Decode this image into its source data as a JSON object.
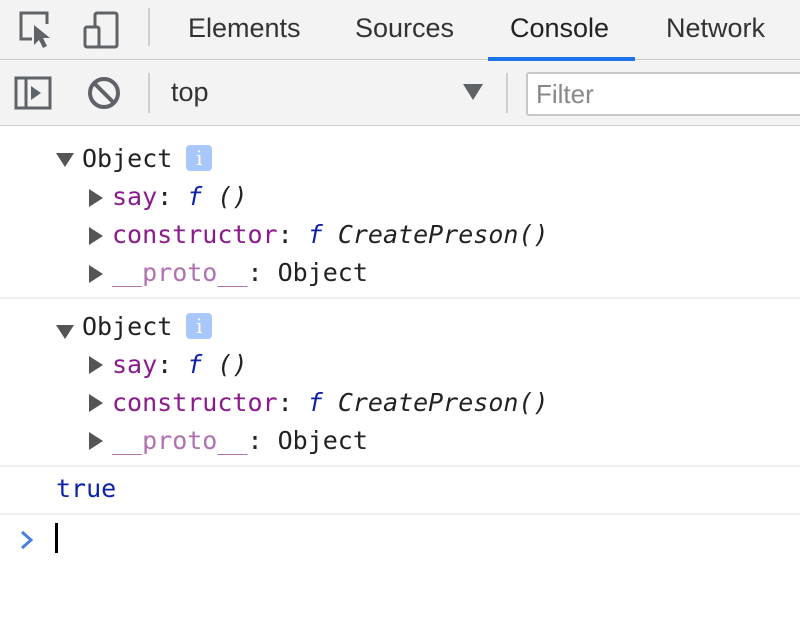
{
  "tabs": [
    {
      "label": "Elements",
      "active": false
    },
    {
      "label": "Sources",
      "active": false
    },
    {
      "label": "Console",
      "active": true
    },
    {
      "label": "Network",
      "active": false
    }
  ],
  "toolbar": {
    "context": "top",
    "filter_placeholder": "Filter"
  },
  "console": {
    "entries": [
      {
        "summary": "Object",
        "info_badge": "i",
        "properties": [
          {
            "key": "say",
            "colon": ":",
            "fn_keyword": "f",
            "value": "()"
          },
          {
            "key": "constructor",
            "colon": ":",
            "fn_keyword": "f",
            "value": "CreatePreson()"
          },
          {
            "key": "__proto__",
            "colon": ":",
            "value": "Object"
          }
        ]
      },
      {
        "summary": "Object",
        "info_badge": "i",
        "properties": [
          {
            "key": "say",
            "colon": ":",
            "fn_keyword": "f",
            "value": "()"
          },
          {
            "key": "constructor",
            "colon": ":",
            "fn_keyword": "f",
            "value": "CreatePreson()"
          },
          {
            "key": "__proto__",
            "colon": ":",
            "value": "Object"
          }
        ]
      }
    ],
    "result": "true"
  },
  "colors": {
    "accent": "#1a73e8",
    "property_key": "#8b1a8b",
    "proto_key": "#b072b0",
    "keyword_blue": "#0d22aa",
    "prompt_blue": "#4a7fe0"
  },
  "icons": {
    "inspect": "inspect-element-icon",
    "device": "device-toolbar-icon",
    "sidebar": "console-sidebar-icon",
    "clear": "clear-console-icon",
    "dropdown": "dropdown-arrow-icon",
    "expand": "expand-triangle-icon",
    "collapse": "collapse-triangle-icon",
    "prompt": "console-prompt-icon"
  }
}
